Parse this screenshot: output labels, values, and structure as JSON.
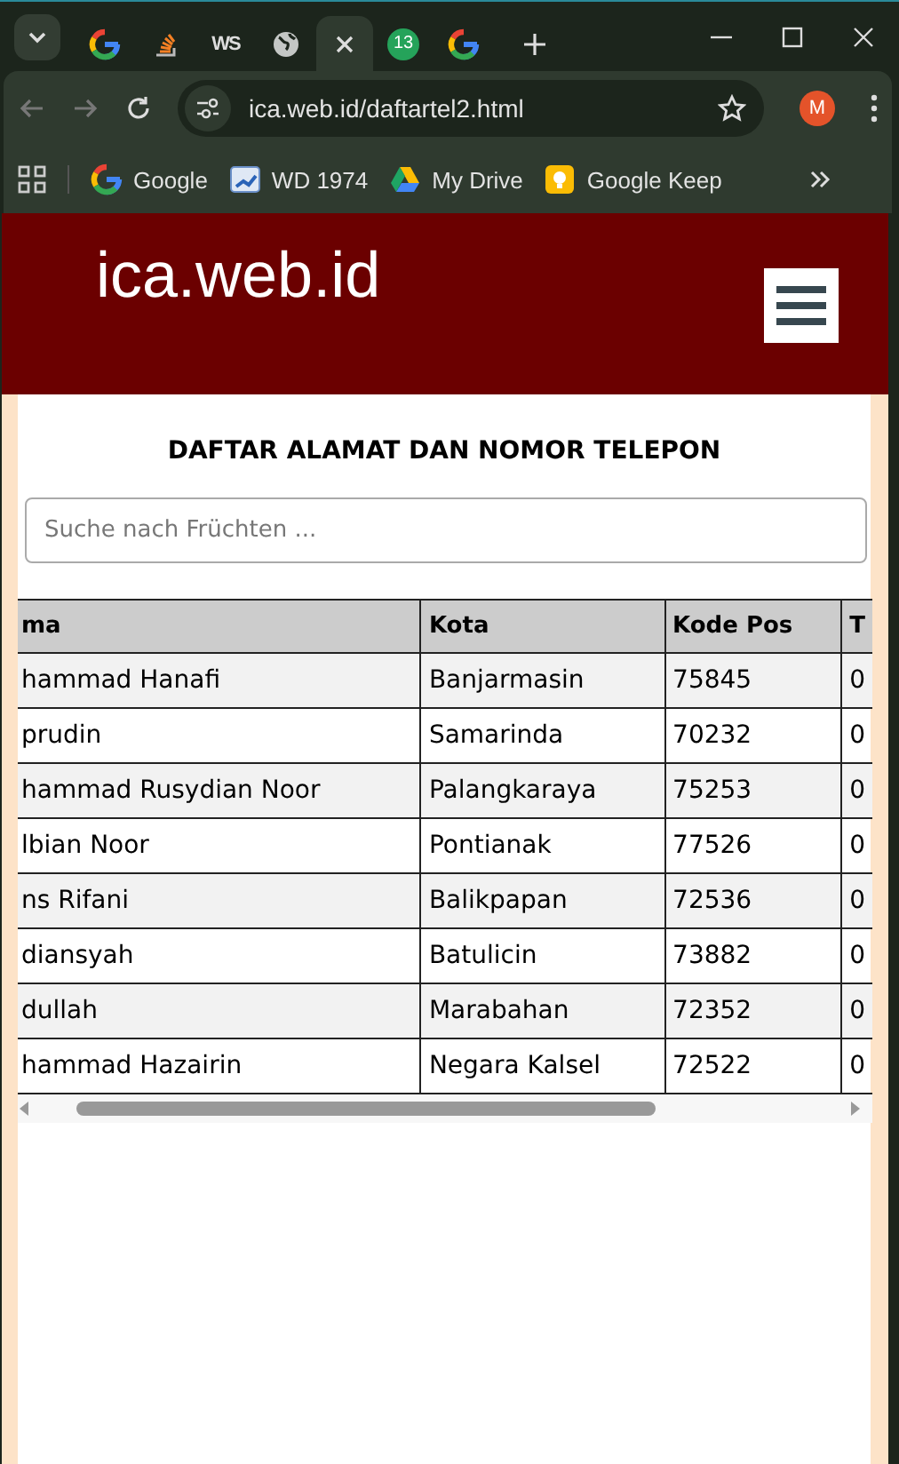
{
  "browser": {
    "tabs": [
      {
        "kind": "google",
        "selected": false
      },
      {
        "kind": "stack",
        "selected": false
      },
      {
        "kind": "text",
        "label": "WS",
        "selected": false
      },
      {
        "kind": "globe",
        "selected": false
      },
      {
        "kind": "close",
        "selected": true
      },
      {
        "kind": "badge",
        "label": "13",
        "selected": false
      },
      {
        "kind": "google",
        "selected": false
      }
    ],
    "address": "ica.web.id/daftartel2.html",
    "profile": "M",
    "bookmarks": [
      {
        "kind": "google",
        "label": "Google"
      },
      {
        "kind": "folder",
        "label": "WD 1974"
      },
      {
        "kind": "drive",
        "label": "My Drive"
      },
      {
        "kind": "keep",
        "label": "Google Keep"
      }
    ]
  },
  "site": {
    "title": "ica.web.id"
  },
  "heading": "DAFTAR ALAMAT DAN NOMOR TELEPON",
  "search": {
    "placeholder": "Suche nach Früchten ..."
  },
  "table": {
    "columns": [
      "ma",
      "Kota",
      "Kode Pos",
      "T"
    ],
    "rows": [
      [
        "hammad Hanafi",
        "Banjarmasin",
        "75845",
        "0"
      ],
      [
        "prudin",
        "Samarinda",
        "70232",
        "0"
      ],
      [
        "hammad Rusydian Noor",
        "Palangkaraya",
        "75253",
        "0"
      ],
      [
        "lbian Noor",
        "Pontianak",
        "77526",
        "0"
      ],
      [
        "ns Rifani",
        "Balikpapan",
        "72536",
        "0"
      ],
      [
        "diansyah",
        "Batulicin",
        "73882",
        "0"
      ],
      [
        "dullah",
        "Marabahan",
        "72352",
        "0"
      ],
      [
        "hammad Hazairin",
        "Negara Kalsel",
        "72522",
        "0"
      ]
    ]
  }
}
